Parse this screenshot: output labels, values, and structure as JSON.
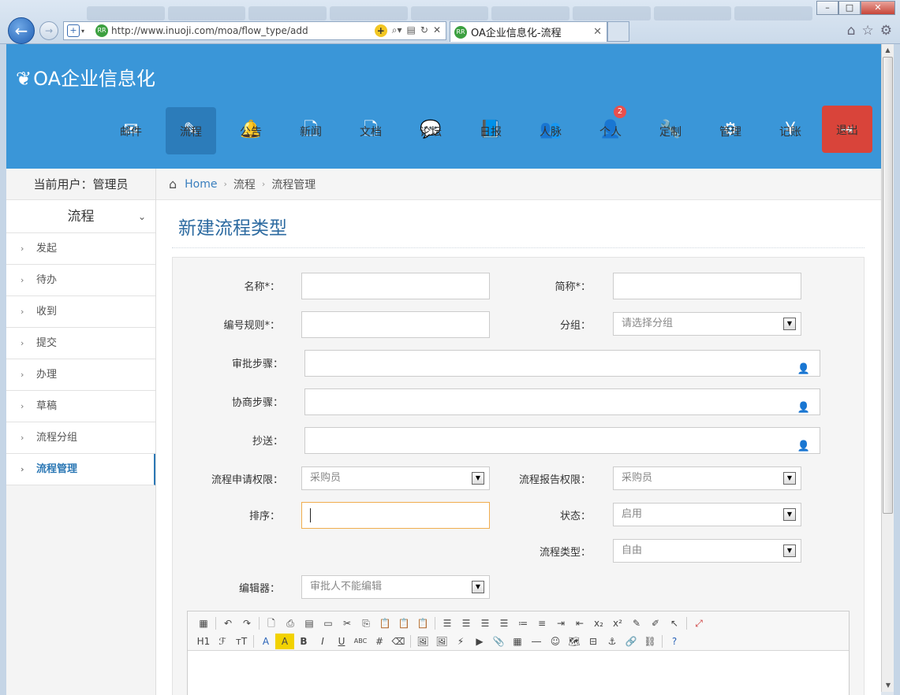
{
  "browser": {
    "url": "http://www.inuoji.com/moa/flow_type/add",
    "tab_title": "OA企业信息化-流程",
    "fav_text": "RR"
  },
  "app": {
    "logo": "OA企业信息化",
    "nav": [
      {
        "label": "邮件",
        "icon": "✉"
      },
      {
        "label": "流程",
        "icon": "✎"
      },
      {
        "label": "公告",
        "icon": "🔔"
      },
      {
        "label": "新闻",
        "icon": "🗋"
      },
      {
        "label": "文档",
        "icon": "🗋"
      },
      {
        "label": "论坛",
        "icon": "💬"
      },
      {
        "label": "日报",
        "icon": "📘"
      },
      {
        "label": "人脉",
        "icon": "👥"
      },
      {
        "label": "个人",
        "icon": "👤",
        "badge": "2"
      },
      {
        "label": "定制",
        "icon": "🔧"
      },
      {
        "label": "管理",
        "icon": "⚙"
      },
      {
        "label": "记账",
        "icon": "¥"
      }
    ],
    "logout": {
      "label": "退出",
      "icon": "⇥"
    }
  },
  "sidebar": {
    "current_user": "当前用户：管理员",
    "group": "流程",
    "items": [
      {
        "label": "发起"
      },
      {
        "label": "待办"
      },
      {
        "label": "收到"
      },
      {
        "label": "提交"
      },
      {
        "label": "办理"
      },
      {
        "label": "草稿"
      },
      {
        "label": "流程分组"
      },
      {
        "label": "流程管理"
      }
    ]
  },
  "breadcrumb": {
    "home": "Home",
    "level1": "流程",
    "level2": "流程管理"
  },
  "page": {
    "title": "新建流程类型"
  },
  "form": {
    "name_label": "名称*：",
    "short_label": "简称*：",
    "code_label": "编号规则*：",
    "group_label": "分组：",
    "group_value": "请选择分组",
    "approve_label": "审批步骤：",
    "consult_label": "协商步骤：",
    "cc_label": "抄送：",
    "apply_perm_label": "流程申请权限：",
    "apply_perm_value": "采购员",
    "report_perm_label": "流程报告权限：",
    "report_perm_value": "采购员",
    "sort_label": "排序：",
    "status_label": "状态：",
    "status_value": "启用",
    "type_label": "流程类型：",
    "type_value": "自由",
    "editor_label": "编辑器：",
    "editor_value": "审批人不能编辑"
  },
  "editor_toolbar": {
    "heading": "H1",
    "bold": "B",
    "italic": "I",
    "underline": "U",
    "strike": "ABC"
  }
}
